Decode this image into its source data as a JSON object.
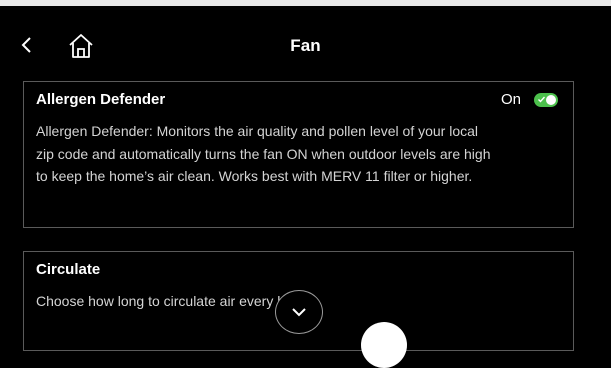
{
  "header": {
    "title": "Fan",
    "back_icon": "chevron-left-icon",
    "home_icon": "home-icon"
  },
  "allergen_card": {
    "title": "Allergen Defender",
    "status": "On",
    "toggle_on": true,
    "description": "Allergen Defender: Monitors the air quality and pollen level of your local zip code and automatically turns the fan ON when outdoor levels are high to keep the home’s air clean. Works best with MERV 11 filter or higher."
  },
  "circulate_card": {
    "title": "Circulate",
    "description": "Choose how long to circulate air every hour."
  },
  "colors": {
    "background": "#000000",
    "accent_green": "#4cc04c",
    "border": "#5a5a5a"
  }
}
